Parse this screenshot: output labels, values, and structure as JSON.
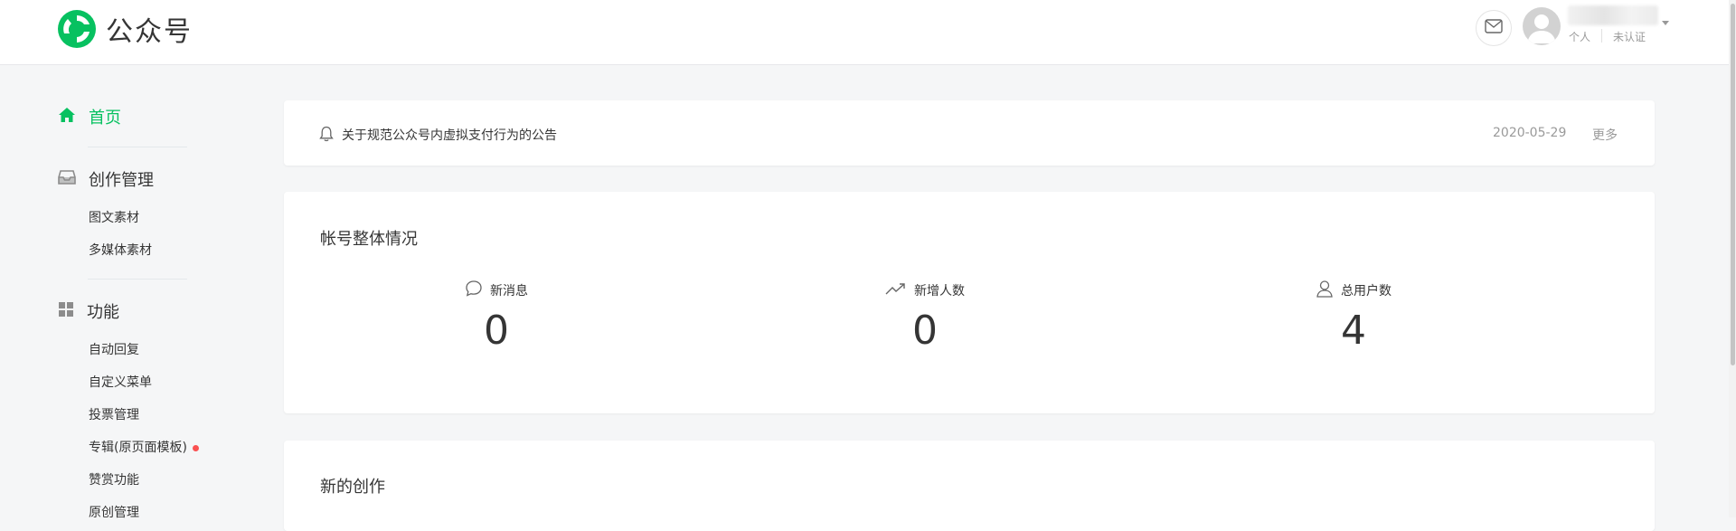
{
  "header": {
    "brand": "公众号",
    "account": {
      "type": "个人",
      "verify": "未认证"
    }
  },
  "sidebar": {
    "home": "首页",
    "groups": [
      {
        "label": "创作管理",
        "icon": "inbox-icon",
        "items": [
          "图文素材",
          "多媒体素材"
        ]
      },
      {
        "label": "功能",
        "icon": "grid-icon",
        "items": [
          "自动回复",
          "自定义菜单",
          "投票管理",
          "专辑(原页面模板)",
          "赞赏功能",
          "原创管理"
        ]
      }
    ]
  },
  "notice": {
    "text": "关于规范公众号内虚拟支付行为的公告",
    "date": "2020-05-29",
    "more": "更多"
  },
  "overview": {
    "title": "帐号整体情况",
    "stats": [
      {
        "label": "新消息",
        "icon": "chat-bubble-icon",
        "value": "0"
      },
      {
        "label": "新增人数",
        "icon": "trend-up-icon",
        "value": "0"
      },
      {
        "label": "总用户数",
        "icon": "user-icon",
        "value": "4"
      }
    ]
  },
  "create": {
    "title": "新的创作"
  },
  "colors": {
    "accent": "#07c160",
    "badge": "#fa5151",
    "background": "#f5f6f7"
  }
}
